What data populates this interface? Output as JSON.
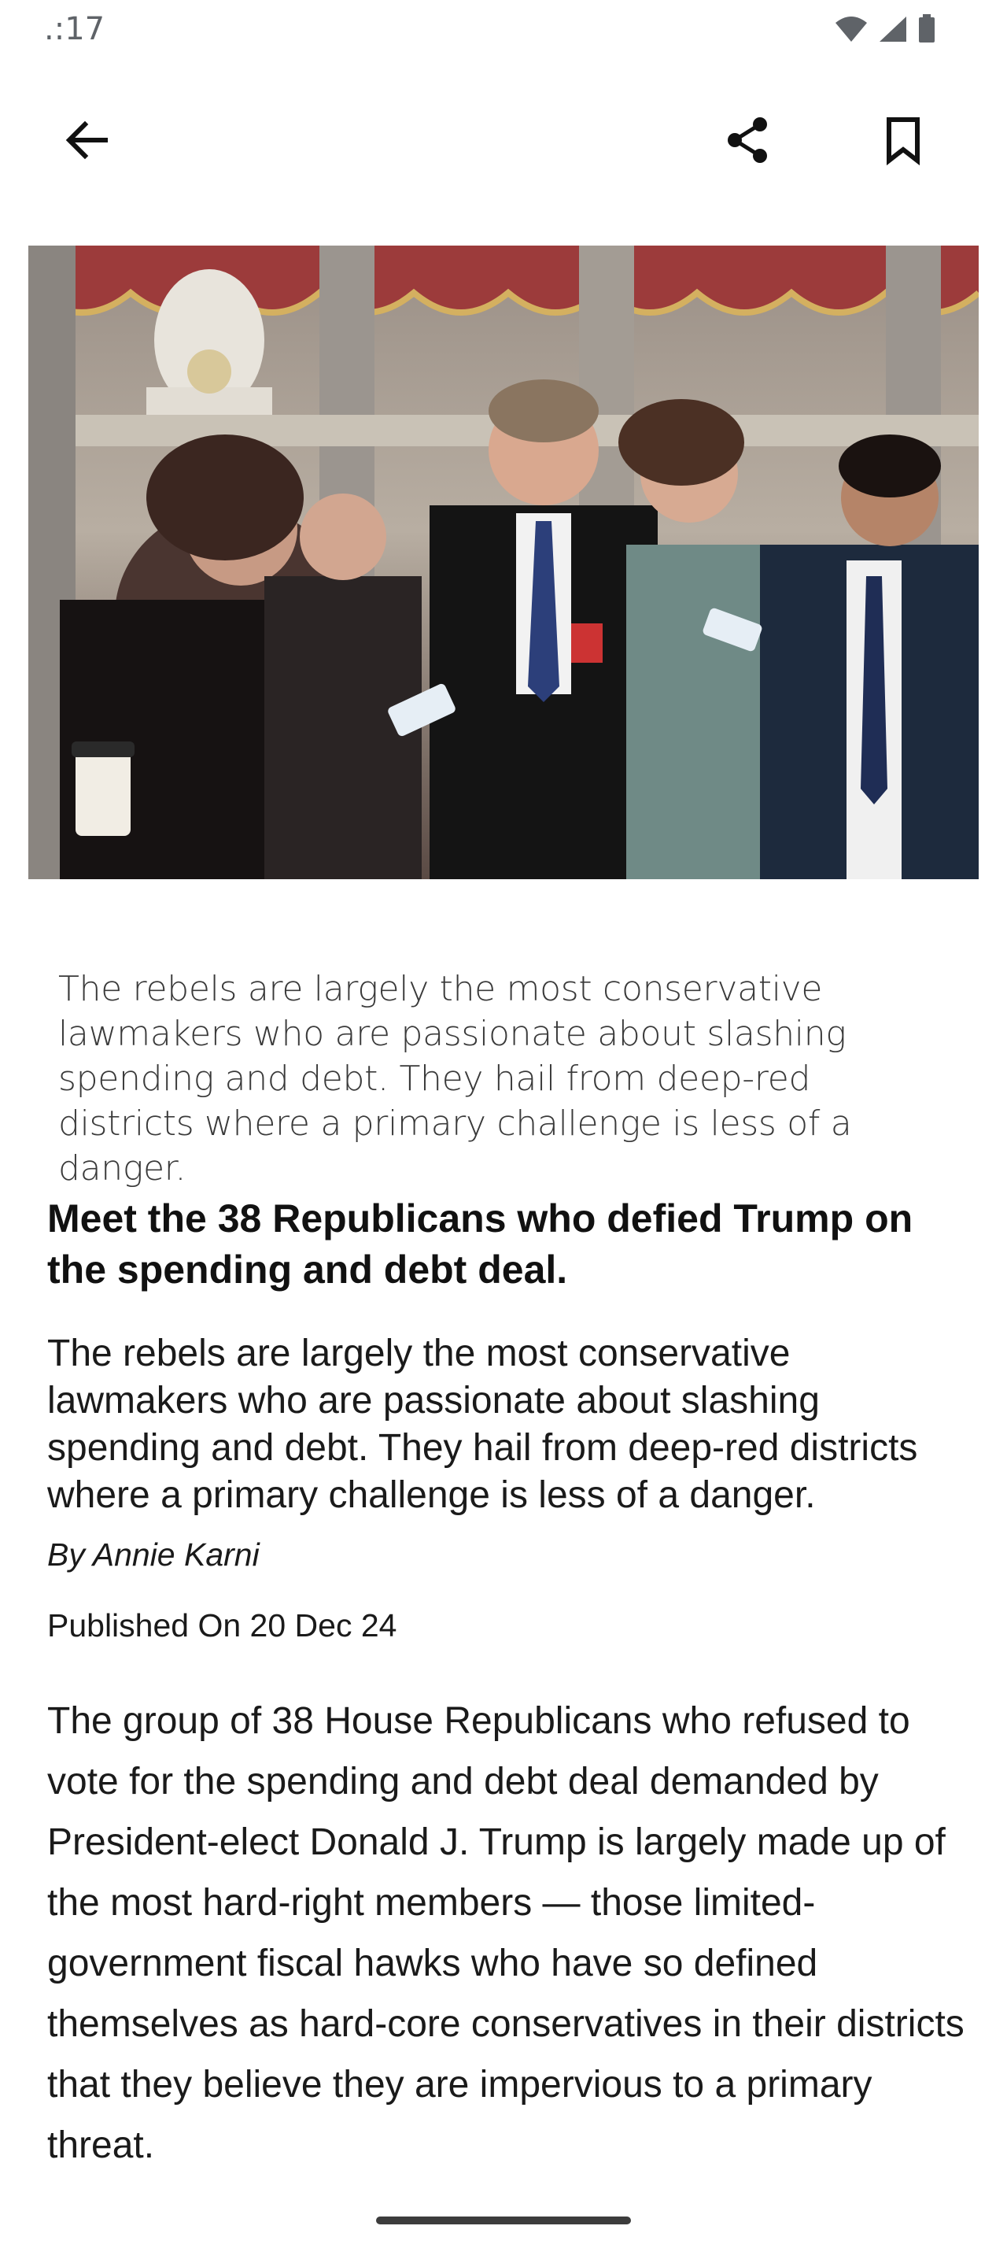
{
  "status_bar": {
    "time": ".:17",
    "icons": [
      "wifi-icon",
      "signal-icon",
      "battery-icon"
    ]
  },
  "toolbar": {
    "back_icon": "arrow-left-icon",
    "share_icon": "share-icon",
    "bookmark_icon": "bookmark-icon"
  },
  "article": {
    "image_caption": "The rebels are largely the most conservative lawmakers who are passionate about slashing spending and debt. They hail from deep-red districts where a primary challenge is less of a danger.",
    "headline": "Meet the 38 Republicans who defied Trump on the spending and debt deal.",
    "summary": "The rebels are largely the most conservative lawmakers who are passionate about slashing spending and debt. They hail from deep-red districts where a primary challenge is less of a danger.",
    "byline": "By Annie Karni",
    "published": "Published On 20 Dec 24",
    "body": "The group of 38 House Republicans who refused to vote for the spending and debt deal demanded by President-elect Donald J. Trump is largely made up of the most hard-right members — those limited-government fiscal hawks who have so defined themselves as hard-core conservatives in their districts that they believe they are impervious to a primary threat."
  },
  "colors": {
    "background": "#ffffff",
    "text": "#1a1a1a",
    "caption_text": "#3a3a3a",
    "icon": "#111111"
  }
}
